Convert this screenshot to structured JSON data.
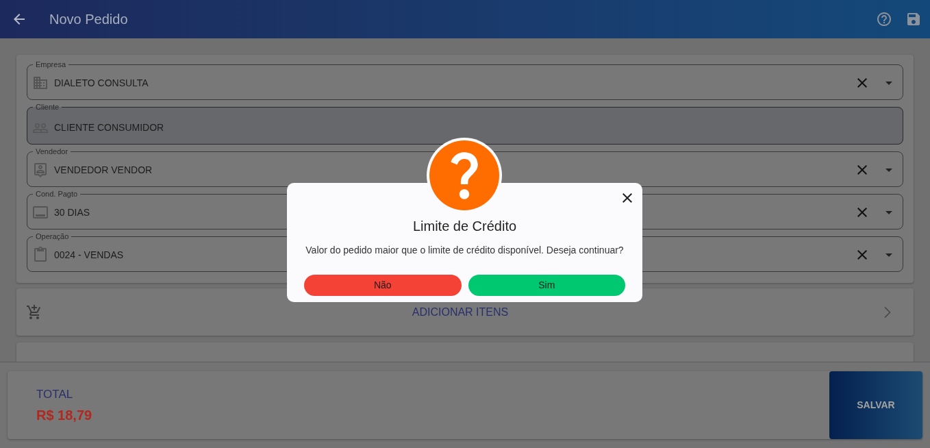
{
  "app_bar": {
    "title": "Novo Pedido"
  },
  "form": {
    "fields": [
      {
        "label": "Empresa",
        "value": "DIALETO CONSULTA",
        "disabled": false
      },
      {
        "label": "Cliente",
        "value": "CLIENTE CONSUMIDOR",
        "disabled": true
      },
      {
        "label": "Vendedor",
        "value": "VENDEDOR VENDOR",
        "disabled": false
      },
      {
        "label": "Cond. Pagto",
        "value": "30 DIAS",
        "disabled": false
      },
      {
        "label": "Operação",
        "value": "0024 - VENDAS",
        "disabled": false
      }
    ]
  },
  "actions": [
    {
      "label": "ADICIONAR ITENS"
    }
  ],
  "footer": {
    "total_label": "TOTAL",
    "total_value": "R$ 18,79",
    "save_button": "SALVAR"
  },
  "dialog": {
    "title": "Limite de Crédito",
    "message": "Valor do pedido maior que o limite de crédito disponível. Deseja continuar?",
    "buttons": [
      {
        "label": "Não",
        "kind": "cancel"
      },
      {
        "label": "Sim",
        "kind": "confirm"
      }
    ]
  }
}
